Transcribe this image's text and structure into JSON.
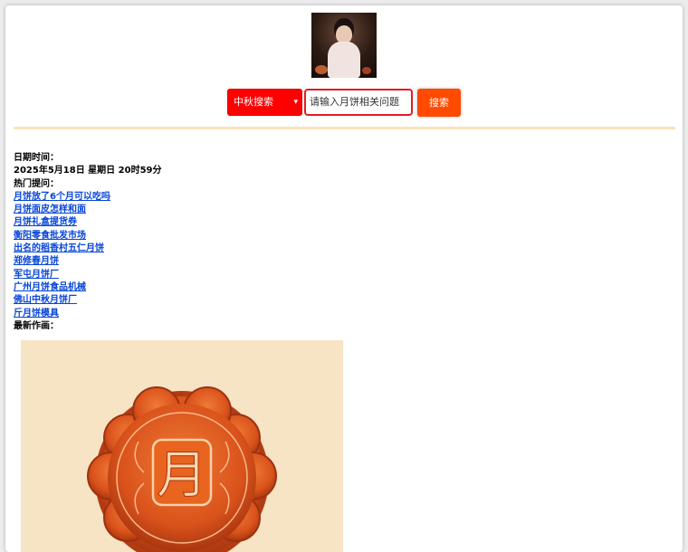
{
  "header": {
    "avatar_alt": "avatar image"
  },
  "search": {
    "category_selected": "中秋搜索",
    "input_placeholder": "请输入月饼相关问题",
    "button_label": "搜索"
  },
  "info": {
    "datetime_label": "日期时间：",
    "datetime_value": "2025年5月18日 星期日 20时59分",
    "hot_questions_label": "热门提问：",
    "hot_questions": [
      "月饼放了6个月可以吃吗",
      "月饼面皮怎样和面",
      "月饼礼盒提货券",
      "衡阳零食批发市场",
      "出名的稻香村五仁月饼",
      "郑修春月饼",
      "军屯月饼厂",
      "广州月饼食品机械",
      "佛山中秋月饼厂",
      "斤月饼模具"
    ],
    "latest_art_label": "最新作画："
  },
  "artwork": {
    "character": "月",
    "background_color": "#f7e4c4",
    "cake_color": "#e2581f"
  },
  "colors": {
    "select_bg": "#ff0000",
    "button_bg": "#ff4a00",
    "input_border": "#e31b23",
    "divider": "#fbe2b8",
    "link": "#0645d8"
  }
}
